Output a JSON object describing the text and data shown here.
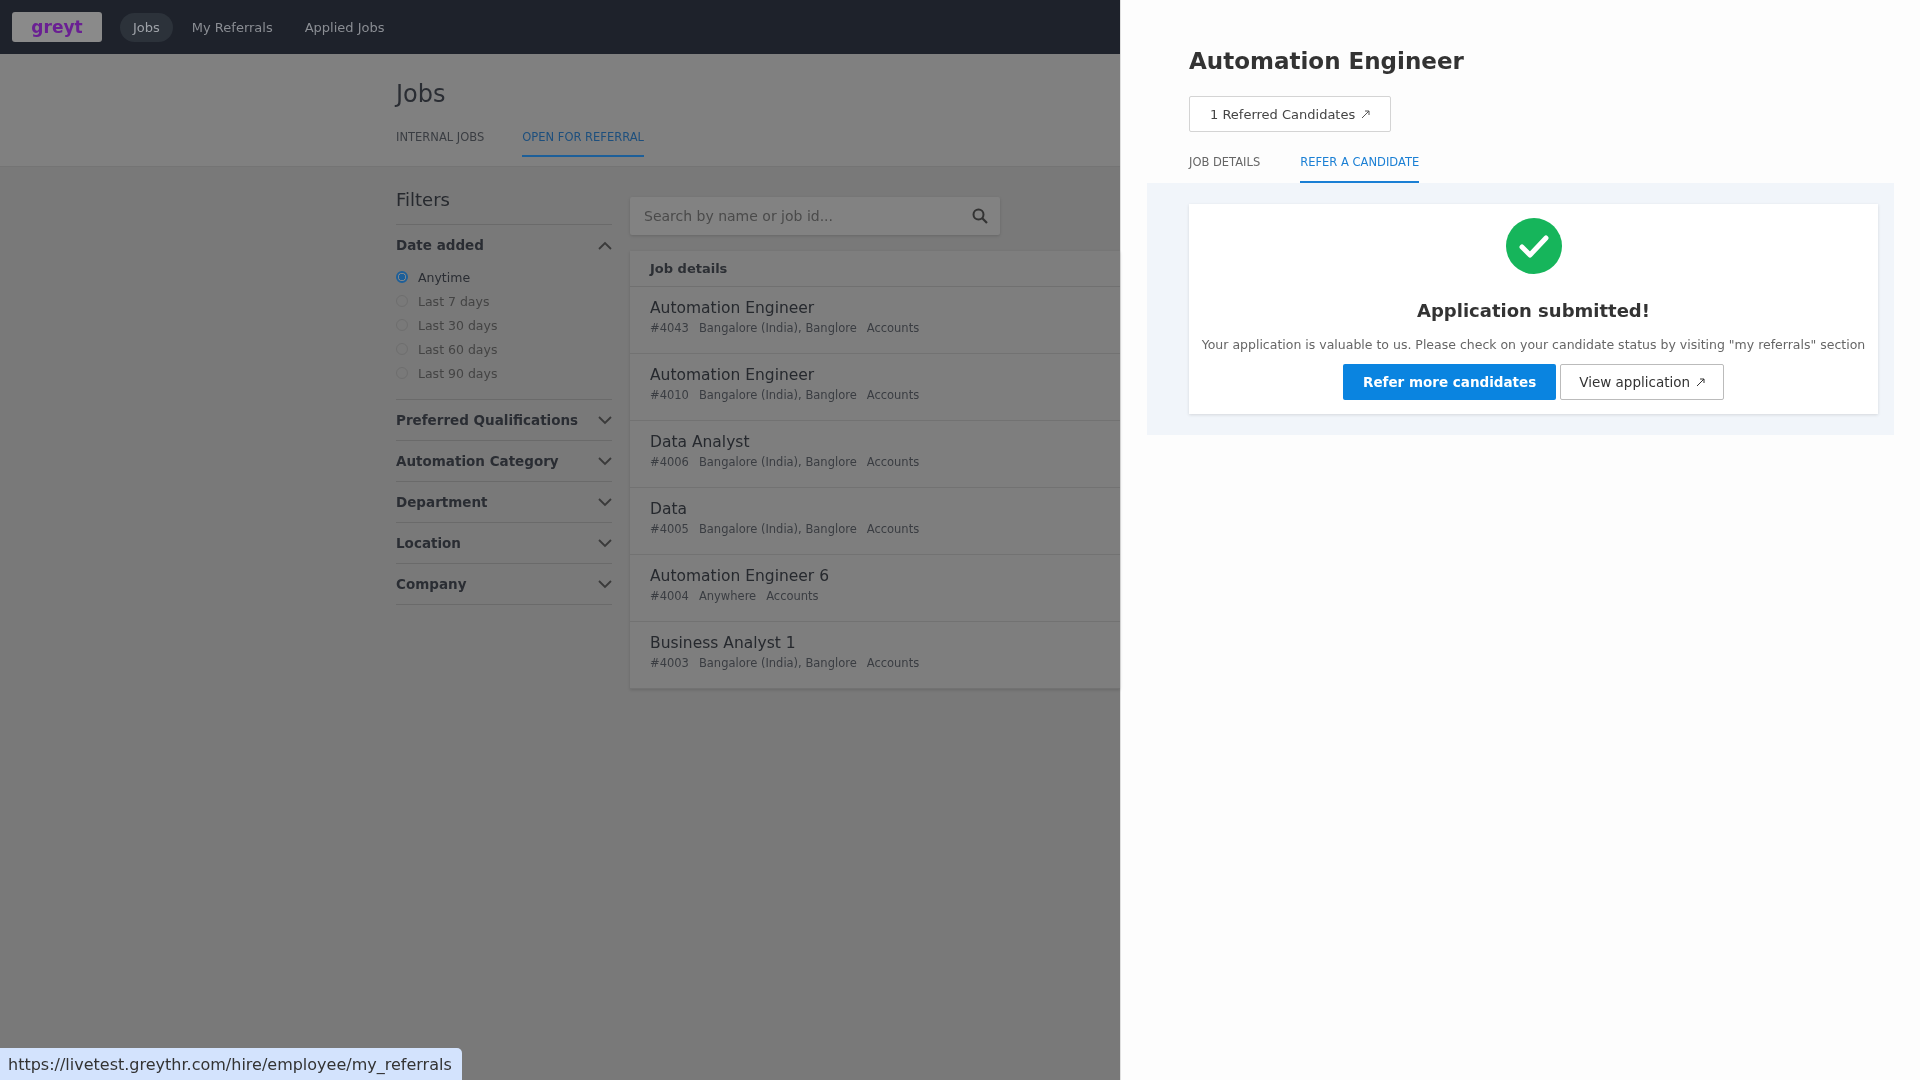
{
  "nav": {
    "logo": "greyt",
    "items": [
      {
        "label": "Jobs",
        "selected": true
      },
      {
        "label": "My Referrals",
        "selected": false
      },
      {
        "label": "Applied Jobs",
        "selected": false
      }
    ]
  },
  "page": {
    "title": "Jobs",
    "tabs": [
      {
        "label": "INTERNAL JOBS",
        "selected": false
      },
      {
        "label": "OPEN FOR REFERRAL",
        "selected": true
      }
    ]
  },
  "filters": {
    "title": "Filters",
    "groups": [
      {
        "label": "Date added",
        "expanded": true,
        "options": [
          {
            "label": "Anytime",
            "selected": true
          },
          {
            "label": "Last 7 days",
            "selected": false
          },
          {
            "label": "Last 30 days",
            "selected": false
          },
          {
            "label": "Last 60 days",
            "selected": false
          },
          {
            "label": "Last 90 days",
            "selected": false
          }
        ]
      },
      {
        "label": "Preferred Qualifications",
        "expanded": false
      },
      {
        "label": "Automation Category",
        "expanded": false
      },
      {
        "label": "Department",
        "expanded": false
      },
      {
        "label": "Location",
        "expanded": false
      },
      {
        "label": "Company",
        "expanded": false
      }
    ]
  },
  "search": {
    "placeholder": "Search by name or job id..."
  },
  "jobs": {
    "header": "Job details",
    "rows": [
      {
        "title": "Automation Engineer",
        "id": "#4043",
        "location": "Bangalore (India), Banglore",
        "department": "Accounts"
      },
      {
        "title": "Automation Engineer",
        "id": "#4010",
        "location": "Bangalore (India), Banglore",
        "department": "Accounts"
      },
      {
        "title": "Data Analyst",
        "id": "#4006",
        "location": "Bangalore (India), Banglore",
        "department": "Accounts"
      },
      {
        "title": "Data",
        "id": "#4005",
        "location": "Bangalore (India), Banglore",
        "department": "Accounts"
      },
      {
        "title": "Automation Engineer 6",
        "id": "#4004",
        "location": "Anywhere",
        "department": "Accounts"
      },
      {
        "title": "Business Analyst 1",
        "id": "#4003",
        "location": "Bangalore (India), Banglore",
        "department": "Accounts"
      }
    ]
  },
  "panel": {
    "title": "Automation Engineer",
    "referred_button": "1 Referred Candidates",
    "tabs": [
      {
        "label": "JOB DETAILS",
        "selected": false
      },
      {
        "label": "REFER A CANDIDATE",
        "selected": true
      }
    ],
    "success": {
      "heading": "Application submitted!",
      "message": "Your application is valuable to us. Please check on your candidate status by visiting \"my referrals\" section",
      "primary_button": "Refer more candidates",
      "secondary_button": "View application"
    }
  },
  "status_bar": {
    "url": "https://livetest.greythr.com/hire/employee/my_referrals"
  }
}
